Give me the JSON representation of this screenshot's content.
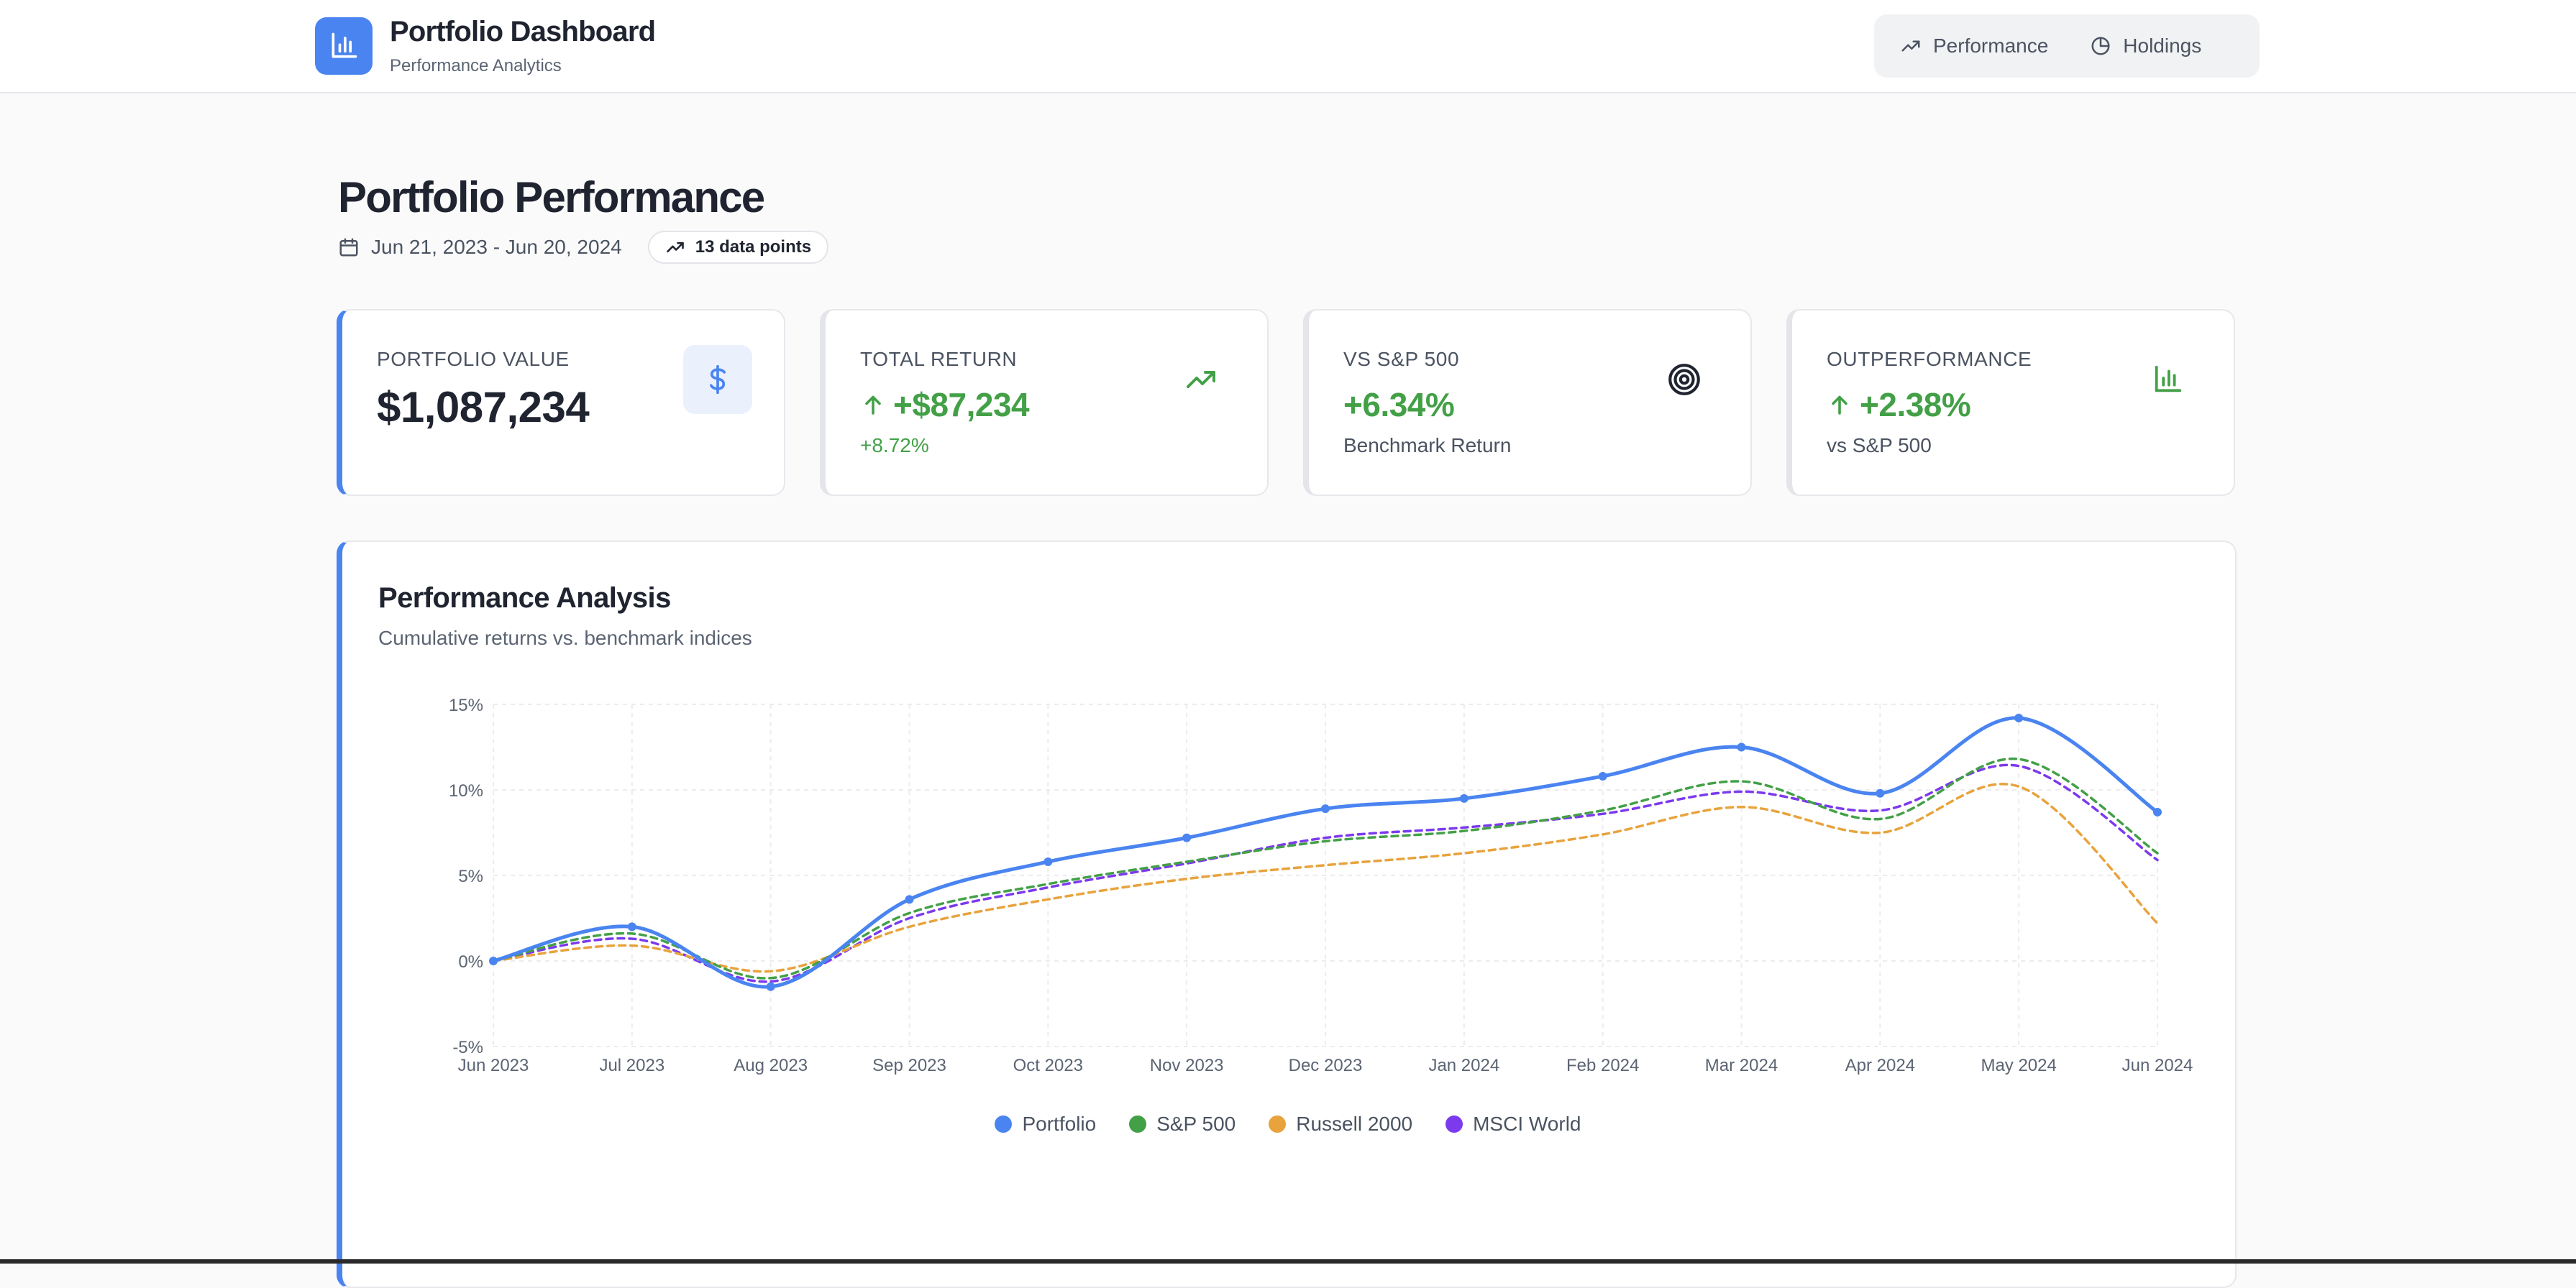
{
  "header": {
    "title": "Portfolio Dashboard",
    "subtitle": "Performance Analytics",
    "logo_icon": "bar-chart-icon",
    "nav": [
      {
        "label": "Performance",
        "icon": "trending-up-icon"
      },
      {
        "label": "Holdings",
        "icon": "pie-chart-icon"
      }
    ]
  },
  "page": {
    "title": "Portfolio Performance",
    "date_range": "Jun 21, 2023 - Jun 20, 2024",
    "data_points_badge": "13 data points"
  },
  "cards": [
    {
      "label": "PORTFOLIO VALUE",
      "value": "$1,087,234",
      "sub": "",
      "icon": "dollar-icon"
    },
    {
      "label": "TOTAL RETURN",
      "value": "+$87,234",
      "sub": "+8.72%",
      "icon": "trending-up-icon"
    },
    {
      "label": "VS S&P 500",
      "value": "+6.34%",
      "sub": "Benchmark Return",
      "icon": "target-icon"
    },
    {
      "label": "OUTPERFORMANCE",
      "value": "+2.38%",
      "sub": "vs S&P 500",
      "icon": "bar-chart-icon"
    }
  ],
  "colors": {
    "accent": "#4a84f0",
    "positive": "#43a047",
    "portfolio": "#4a84f0",
    "sp500": "#43a047",
    "russell": "#e8a33d",
    "msci": "#7c3aed"
  },
  "chart": {
    "title": "Performance Analysis",
    "subtitle": "Cumulative returns vs. benchmark indices"
  },
  "chart_data": {
    "type": "line",
    "x": [
      "Jun 2023",
      "Jul 2023",
      "Aug 2023",
      "Sep 2023",
      "Oct 2023",
      "Nov 2023",
      "Dec 2023",
      "Jan 2024",
      "Feb 2024",
      "Mar 2024",
      "Apr 2024",
      "May 2024",
      "Jun 2024"
    ],
    "series": [
      {
        "name": "Portfolio",
        "color": "#4a84f0",
        "style": "solid",
        "markers": true,
        "values": [
          0,
          2.0,
          -1.5,
          3.6,
          5.8,
          7.2,
          8.9,
          9.5,
          10.8,
          12.5,
          9.8,
          14.2,
          8.7
        ]
      },
      {
        "name": "S&P 500",
        "color": "#43a047",
        "style": "dashed",
        "markers": false,
        "values": [
          0,
          1.6,
          -1.0,
          2.8,
          4.5,
          5.8,
          7.0,
          7.6,
          8.8,
          10.5,
          8.3,
          11.8,
          6.3
        ]
      },
      {
        "name": "Russell 2000",
        "color": "#e8a33d",
        "style": "dashed",
        "markers": false,
        "values": [
          0,
          0.9,
          -0.6,
          2.0,
          3.6,
          4.8,
          5.6,
          6.3,
          7.4,
          9.0,
          7.5,
          10.2,
          2.2
        ]
      },
      {
        "name": "MSCI World",
        "color": "#7c3aed",
        "style": "dashed",
        "markers": false,
        "values": [
          0,
          1.3,
          -1.2,
          2.5,
          4.3,
          5.7,
          7.2,
          7.8,
          8.6,
          9.9,
          8.8,
          11.4,
          5.9
        ]
      }
    ],
    "y_ticks": [
      "15%",
      "10%",
      "5%",
      "0%",
      "-5%"
    ],
    "ylim": [
      -5,
      15
    ],
    "grid": true,
    "legend_position": "bottom-center"
  }
}
